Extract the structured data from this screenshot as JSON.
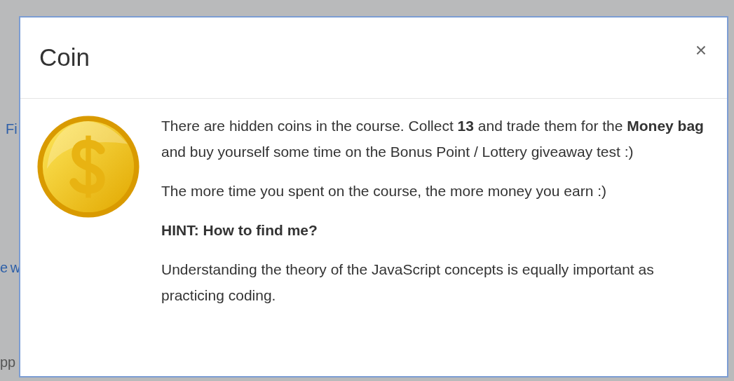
{
  "background": {
    "fragments": [
      {
        "text": "Fi",
        "kind": "link"
      },
      {
        "text": "e w",
        "kind": "link"
      },
      {
        "text": "pp",
        "kind": "text"
      }
    ]
  },
  "dialog": {
    "title": "Coin",
    "close": "×",
    "paragraphs": [
      {
        "kind": "text",
        "text": "There are hidden coins in the course. Collect **13** and trade them for the **Money bag** and buy yourself some time on the Bonus Point / Lottery giveaway test :)"
      },
      {
        "kind": "text",
        "text": "The more time you spent on the course, the more money you earn :)"
      },
      {
        "kind": "heading",
        "text": "HINT: How to find me?"
      },
      {
        "kind": "text",
        "text": "Understanding the theory of the JavaScript concepts is equally important as practicing coding."
      }
    ]
  }
}
